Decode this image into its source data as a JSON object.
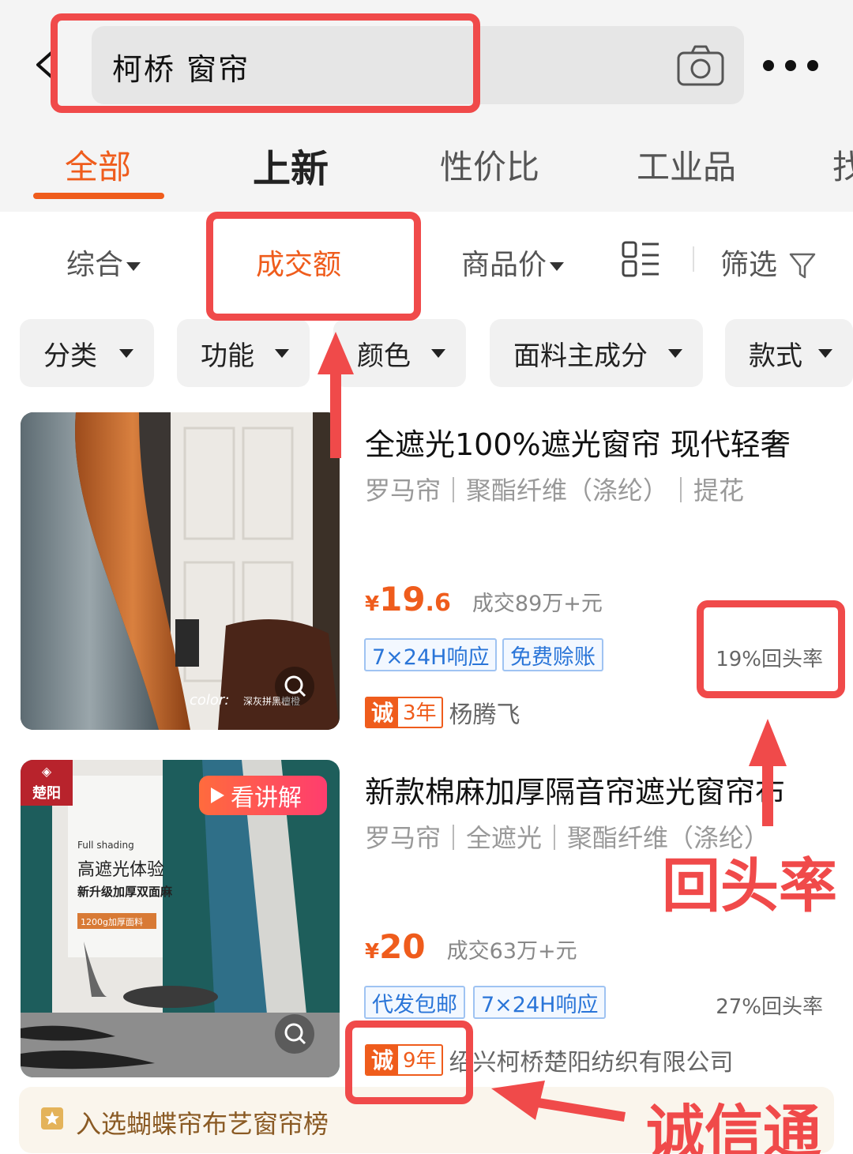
{
  "search": {
    "query": "柯桥 窗帘"
  },
  "tabs": [
    {
      "label": "全部"
    },
    {
      "label": "上新"
    },
    {
      "label": "性价比"
    },
    {
      "label": "工业品"
    },
    {
      "label": "找"
    }
  ],
  "sortbar": {
    "comprehensive": "综合",
    "turnover": "成交额",
    "price": "商品价",
    "filter": "筛选"
  },
  "chips": [
    {
      "label": "分类"
    },
    {
      "label": "功能"
    },
    {
      "label": "颜色"
    },
    {
      "label": "面料主成分"
    },
    {
      "label": "款式"
    }
  ],
  "products": [
    {
      "title": "全遮光100%遮光窗帘 现代轻奢",
      "tags": "罗马帘｜聚酯纤维（涤纶）｜提花",
      "price_symbol": "¥",
      "price_int": "19",
      "price_dec": ".6",
      "sold": "成交89万+元",
      "badges": [
        "7×24H响应",
        "免费赊账"
      ],
      "repeat_rate": "19%回头率",
      "cheng_label": "诚",
      "years": "3年",
      "seller": "杨腾飞",
      "image_caption": "color:",
      "image_caption_detail": "深灰拼黑檀橙"
    },
    {
      "title": "新款棉麻加厚隔音帘遮光窗帘布",
      "tags": "罗马帘｜全遮光｜聚酯纤维（涤纶）",
      "price_symbol": "¥",
      "price_int": "20",
      "price_dec": "",
      "sold": "成交63万+元",
      "badges": [
        "代发包邮",
        "7×24H响应"
      ],
      "repeat_rate": "27%回头率",
      "cheng_label": "诚",
      "years": "9年",
      "seller": "绍兴柯桥楚阳纺织有限公司",
      "video_label": "看讲解",
      "brand": "楚阳",
      "image_line1": "Full shading",
      "image_line2": "高遮光体验",
      "image_line3": "新升级加厚双面麻",
      "image_line4": "1200g加厚面料"
    }
  ],
  "rank": {
    "text": "入选蝴蝶帘布艺窗帘榜"
  },
  "annotations": {
    "repeat_label": "回头率",
    "cheng_label": "诚信通"
  },
  "colors": {
    "accent": "#ef5c1c",
    "annotation": "#f04a4a",
    "badge_blue": "#2a75d8"
  }
}
